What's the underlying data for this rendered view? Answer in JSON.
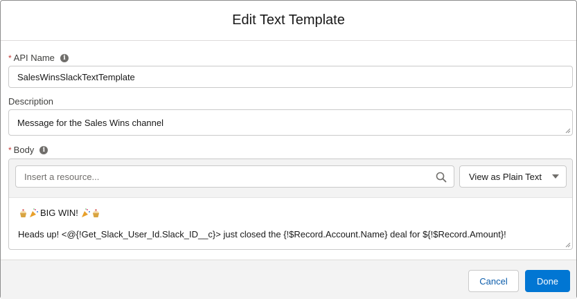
{
  "header": {
    "title": "Edit Text Template"
  },
  "api_name": {
    "required_mark": "*",
    "label": "API Name",
    "value": "SalesWinsSlackTextTemplate"
  },
  "description": {
    "label": "Description",
    "value": "Message for the Sales Wins channel"
  },
  "body": {
    "required_mark": "*",
    "label": "Body",
    "resource_placeholder": "Insert a resource...",
    "view_mode": "View as Plain Text",
    "line1_text": "BIG WIN!",
    "line2_text": "Heads up! <@{!Get_Slack_User_Id.Slack_ID__c}> just closed the {!$Record.Account.Name} deal for ${!$Record.Amount}!"
  },
  "footer": {
    "cancel_label": "Cancel",
    "done_label": "Done"
  },
  "colors": {
    "brand": "#0176d3",
    "required": "#c23934"
  }
}
